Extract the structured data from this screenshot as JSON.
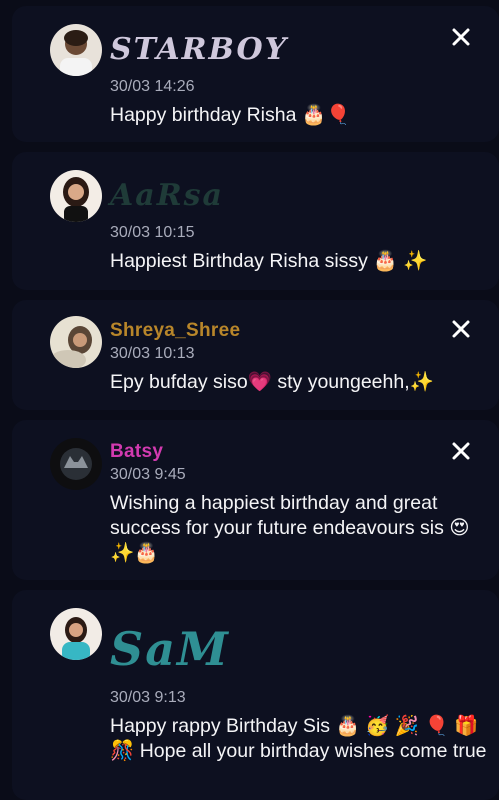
{
  "comments": [
    {
      "name": "STARBOY",
      "time": "30/03 14:26",
      "text": "Happy birthday Risha 🎂🎈",
      "name_color": "#c9c3d8",
      "has_close": true
    },
    {
      "name": "AaRsa",
      "time": "30/03 10:15",
      "text": "Happiest Birthday Risha sissy 🎂 ✨",
      "name_color": "#1f3b38",
      "has_close": false
    },
    {
      "name": "Shreya_Shree",
      "time": "30/03 10:13",
      "text": "Epy bufday siso💗 sty youngeehh,✨",
      "name_color": "#b8862a",
      "has_close": true
    },
    {
      "name": "Batsy",
      "time": "30/03 9:45",
      "text": "Wishing a happiest birthday and great success for your future endeavours sis 😍✨🎂",
      "name_color": "#d23ab0",
      "has_close": true
    },
    {
      "name": "SaM",
      "time": "30/03 9:13",
      "text": "Happy rappy Birthday Sis 🎂 🥳 🎉 🎈 🎁 🎊 Hope all your birthday wishes come true",
      "name_color": "#2f8f93",
      "has_close": false
    }
  ],
  "icons": {
    "close": "close-icon",
    "avatar": "avatar"
  }
}
